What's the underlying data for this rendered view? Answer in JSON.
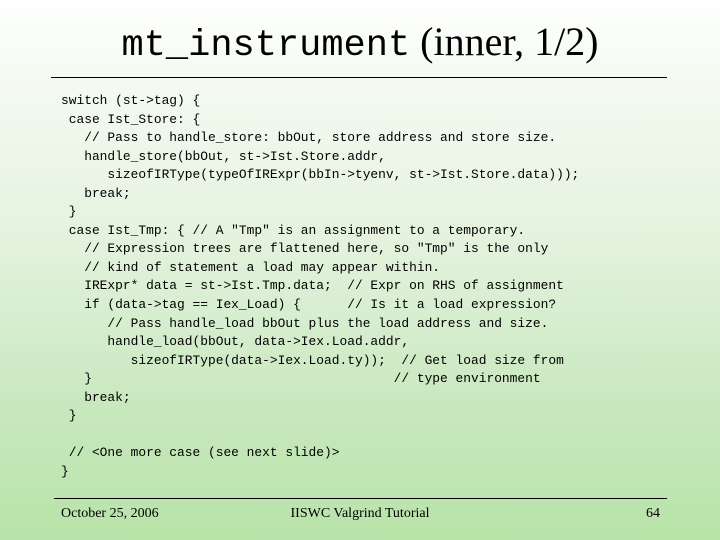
{
  "slide": {
    "title": {
      "code_part": "mt_instrument",
      "text_part": " (inner, 1/2)"
    },
    "code_lines": [
      "switch (st->tag) {",
      " case Ist_Store: {",
      "   // Pass to handle_store: bbOut, store address and store size.",
      "   handle_store(bbOut, st->Ist.Store.addr,",
      "      sizeofIRType(typeOfIRExpr(bbIn->tyenv, st->Ist.Store.data)));",
      "   break;",
      " }",
      " case Ist_Tmp: { // A \"Tmp\" is an assignment to a temporary.",
      "   // Expression trees are flattened here, so \"Tmp\" is the only",
      "   // kind of statement a load may appear within.",
      "   IRExpr* data = st->Ist.Tmp.data;  // Expr on RHS of assignment",
      "   if (data->tag == Iex_Load) {      // Is it a load expression?",
      "      // Pass handle_load bbOut plus the load address and size.",
      "      handle_load(bbOut, data->Iex.Load.addr,",
      "         sizeofIRType(data->Iex.Load.ty));  // Get load size from",
      "   }                                       // type environment",
      "   break;",
      " }",
      "",
      " // <One more case (see next slide)>",
      "}"
    ],
    "footer": {
      "date": "October 25, 2006",
      "center": "IISWC Valgrind Tutorial",
      "page_number": "64"
    }
  }
}
